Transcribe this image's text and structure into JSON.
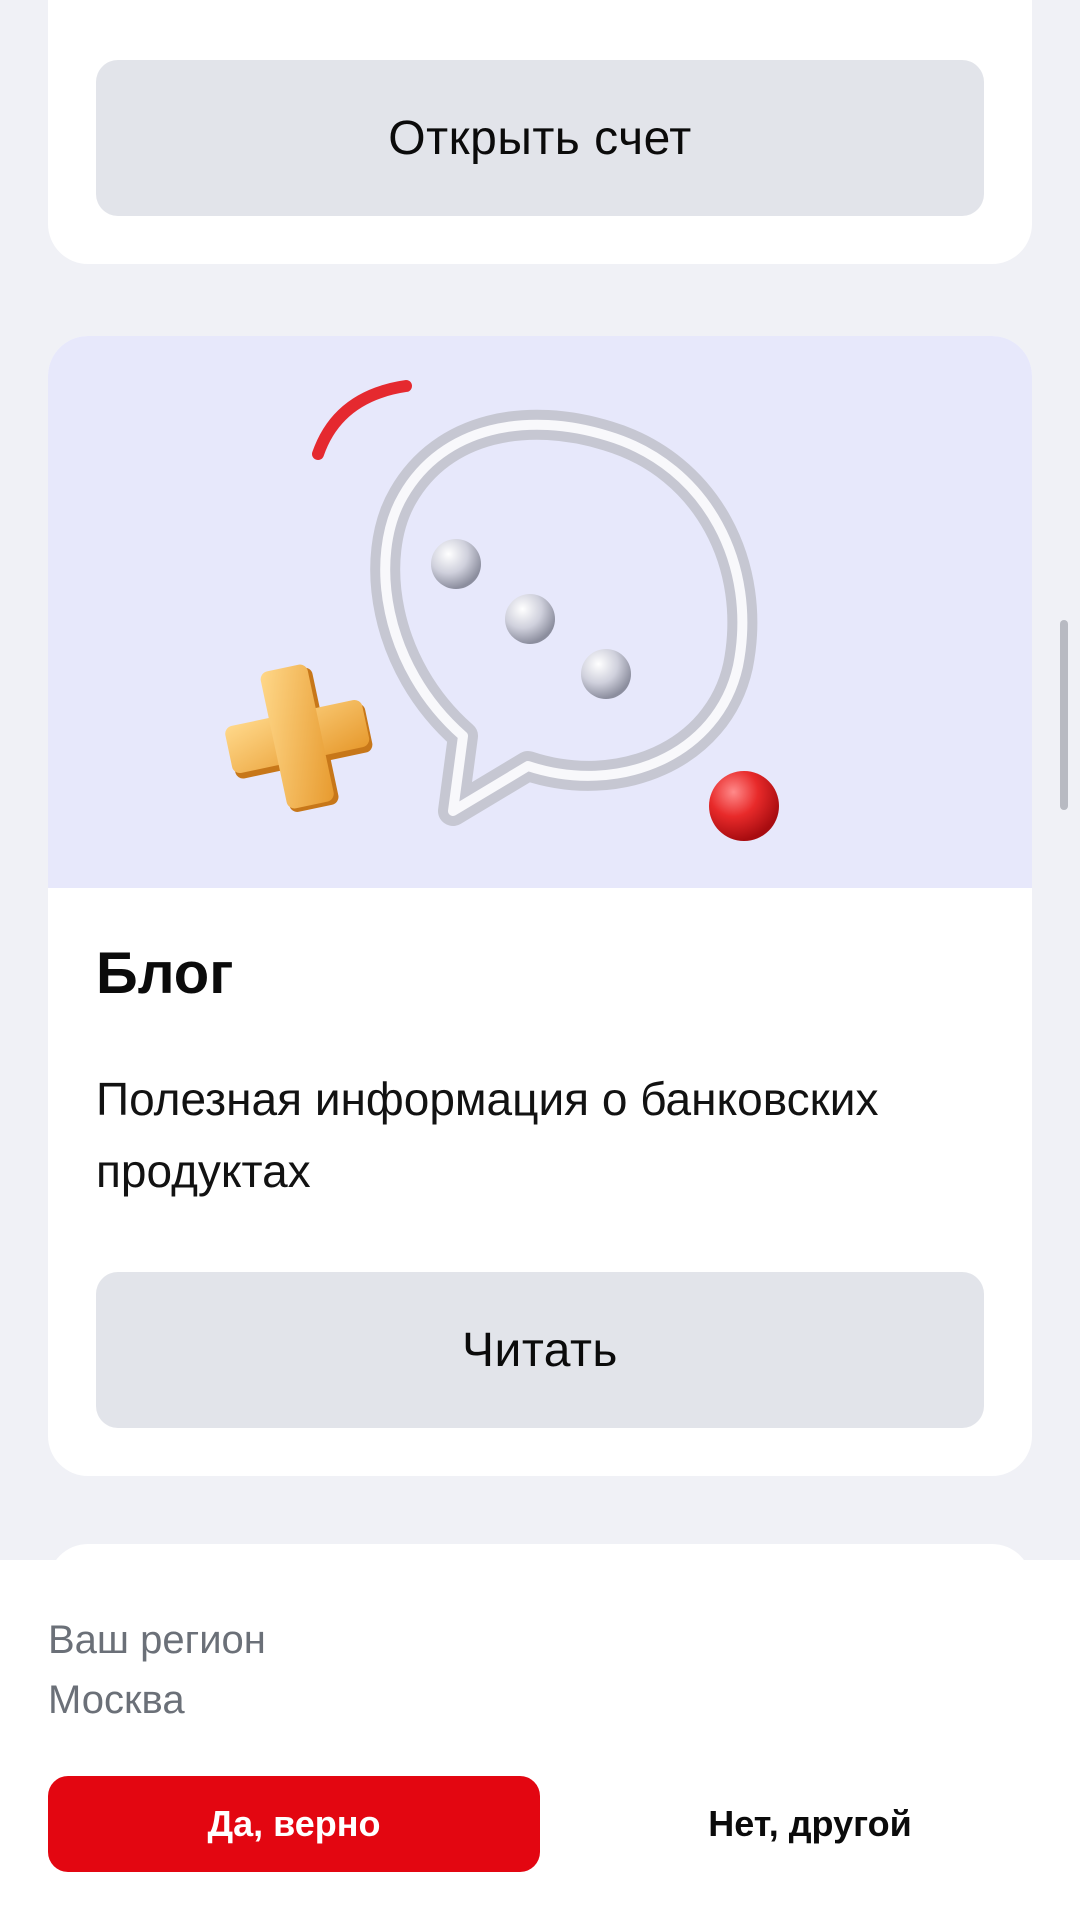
{
  "account_card": {
    "open_account_label": "Открыть счет"
  },
  "blog_card": {
    "title": "Блог",
    "description": "Полезная информация о банковских продуктах",
    "read_label": "Читать",
    "illustration": "chat-bubble-illustration"
  },
  "region_prompt": {
    "label": "Ваш регион",
    "city": "Москва",
    "confirm_label": "Да, верно",
    "decline_label": "Нет, другой"
  },
  "colors": {
    "accent": "#e30611",
    "button_gray": "#e2e4ea",
    "hero_background": "#e7e8fb",
    "page_background": "#f0f1f6"
  }
}
